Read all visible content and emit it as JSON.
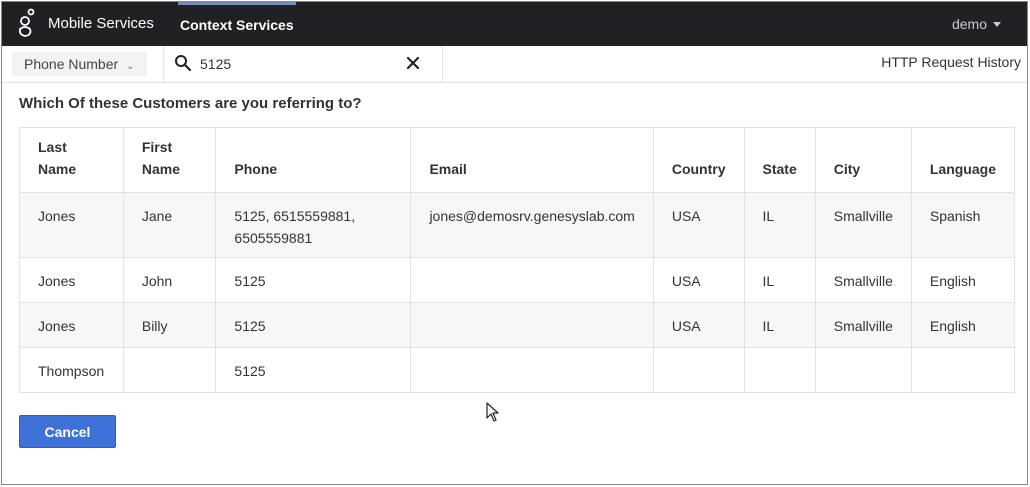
{
  "header": {
    "app_name": "Mobile Services",
    "active_tab": "Context Services",
    "user": "demo"
  },
  "search": {
    "field_select": "Phone Number",
    "query": "5125",
    "history_link": "HTTP Request History"
  },
  "question": "Which Of these Customers are you referring to?",
  "table": {
    "columns": [
      "Last Name",
      "First Name",
      "Phone",
      "Email",
      "Country",
      "State",
      "City",
      "Language"
    ],
    "rows": [
      {
        "last": "Jones",
        "first": "Jane",
        "phone": "5125, 6515559881, 6505559881",
        "email": "jones@demosrv.genesyslab.com",
        "country": "USA",
        "state": "IL",
        "city": "Smallville",
        "language": "Spanish"
      },
      {
        "last": "Jones",
        "first": "John",
        "phone": "5125",
        "email": "",
        "country": "USA",
        "state": "IL",
        "city": "Smallville",
        "language": "English"
      },
      {
        "last": "Jones",
        "first": "Billy",
        "phone": "5125",
        "email": "",
        "country": "USA",
        "state": "IL",
        "city": "Smallville",
        "language": "English"
      },
      {
        "last": "Thompson",
        "first": "",
        "phone": "5125",
        "email": "",
        "country": "",
        "state": "",
        "city": "",
        "language": ""
      }
    ]
  },
  "actions": {
    "cancel_label": "Cancel"
  },
  "colors": {
    "topbar": "#202124",
    "accent": "#3f72d8",
    "tab_underline": "#7b8bb5"
  }
}
